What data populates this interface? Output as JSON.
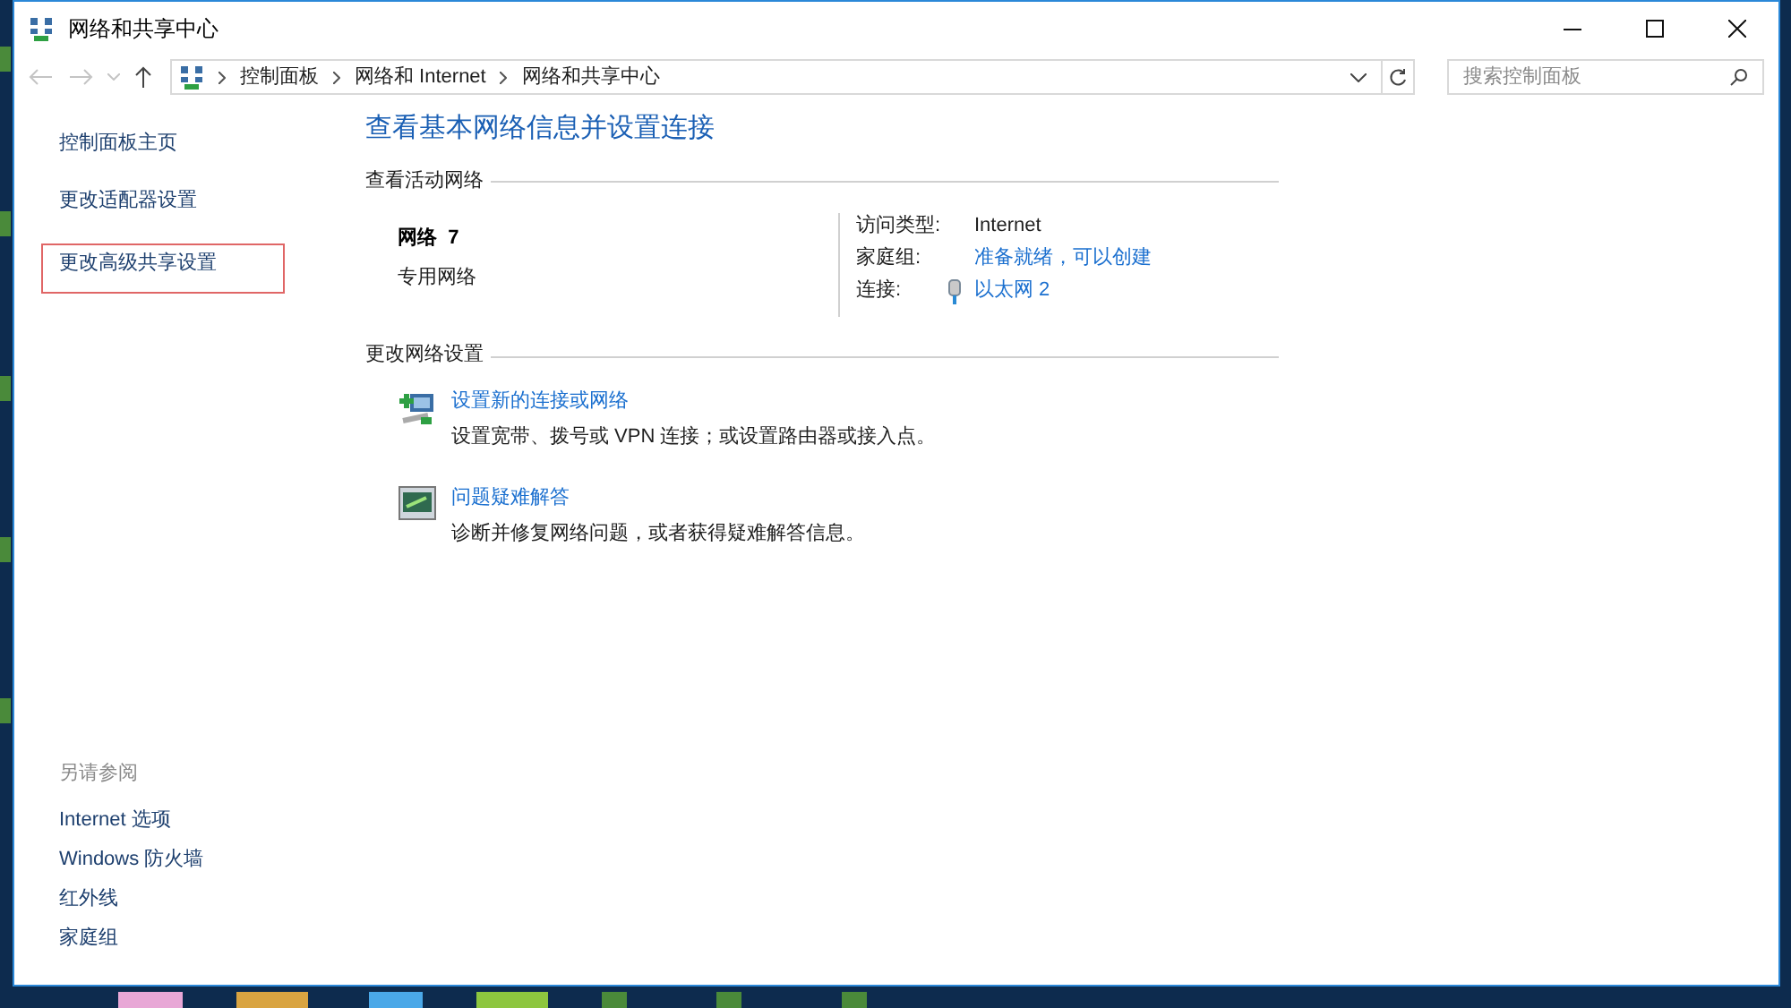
{
  "window": {
    "title": "网络和共享中心"
  },
  "address_bar": {
    "crumbs": [
      "控制面板",
      "网络和 Internet",
      "网络和共享中心"
    ]
  },
  "search": {
    "placeholder": "搜索控制面板"
  },
  "sidebar": {
    "items": [
      {
        "label": "控制面板主页",
        "selected": false
      },
      {
        "label": "更改适配器设置",
        "selected": false
      },
      {
        "label": "更改高级共享设置",
        "selected": true
      }
    ],
    "see_also": {
      "heading": "另请参阅",
      "items": [
        "Internet 选项",
        "Windows 防火墙",
        "红外线",
        "家庭组"
      ]
    }
  },
  "main": {
    "title": "查看基本网络信息并设置连接",
    "active_networks": {
      "heading": "查看活动网络",
      "network_name": "网络  7",
      "network_type": "专用网络",
      "details": [
        {
          "label": "访问类型:",
          "value": "Internet",
          "kind": "text"
        },
        {
          "label": "家庭组:",
          "value": "准备就绪，可以创建",
          "kind": "link"
        },
        {
          "label": "连接:",
          "value": "以太网 2",
          "kind": "connection"
        }
      ]
    },
    "change_settings": {
      "heading": "更改网络设置",
      "tasks": [
        {
          "title": "设置新的连接或网络",
          "description": "设置宽带、拨号或 VPN 连接；或设置路由器或接入点。",
          "kind": "new-connection"
        },
        {
          "title": "问题疑难解答",
          "description": "诊断并修复网络问题，或者获得疑难解答信息。",
          "kind": "troubleshoot"
        }
      ]
    }
  }
}
